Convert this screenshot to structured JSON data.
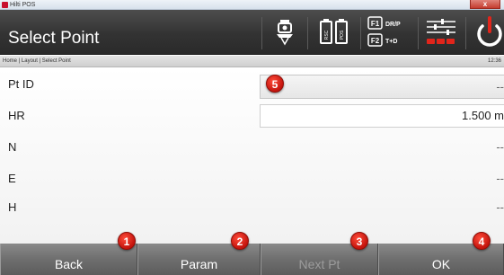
{
  "window": {
    "title": "Hilti POS",
    "close_glyph": "x"
  },
  "header": {
    "title": "Select Point",
    "icons": [
      "instrument-icon",
      "battery-icon",
      "function-keys-icon",
      "settings-icon",
      "power-icon"
    ],
    "f1": {
      "key": "F1",
      "label": "DR/P"
    },
    "f2": {
      "key": "F2",
      "label": "T+D"
    },
    "battery_labels": [
      "RSC",
      "POS"
    ],
    "power_color": "#e1251b"
  },
  "breadcrumb": {
    "path": "Home | Layout | Select Point",
    "time": "12:36"
  },
  "fields": [
    {
      "label": "Pt ID",
      "value": "--"
    },
    {
      "label": "HR",
      "value": "1.500 m"
    },
    {
      "label": "N",
      "value": "--"
    },
    {
      "label": "E",
      "value": "--"
    },
    {
      "label": "H",
      "value": "--"
    }
  ],
  "softkeys": [
    {
      "label": "Back",
      "enabled": true
    },
    {
      "label": "Param",
      "enabled": true
    },
    {
      "label": "Next Pt",
      "enabled": false
    },
    {
      "label": "OK",
      "enabled": true
    }
  ],
  "callouts": [
    "1",
    "2",
    "3",
    "4",
    "5"
  ],
  "colors": {
    "accent_red": "#e1251b",
    "header_bg": "#333333",
    "softkey_bg": "#6e6e6e"
  }
}
